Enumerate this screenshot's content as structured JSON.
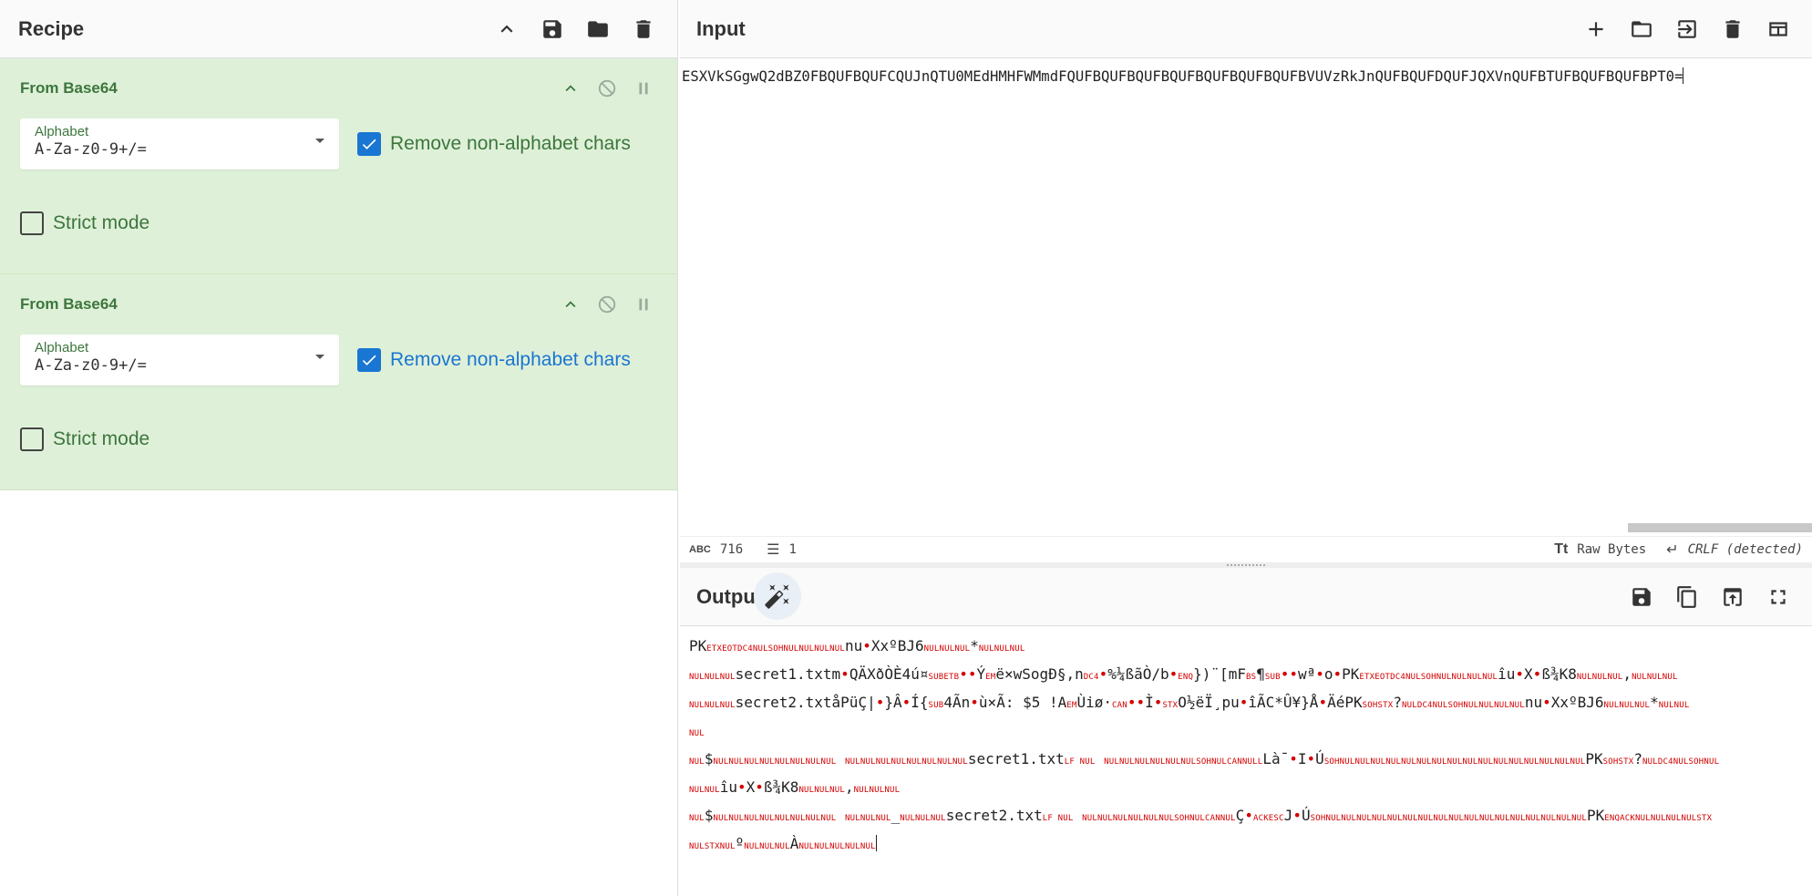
{
  "recipe": {
    "title": "Recipe",
    "operations": [
      {
        "title": "From Base64",
        "alphabet_label": "Alphabet",
        "alphabet_value": "A-Za-z0-9+/=",
        "remove_non_alpha_label": "Remove non-alphabet chars",
        "remove_non_alpha_checked": true,
        "strict_mode_label": "Strict mode",
        "strict_mode_checked": false
      },
      {
        "title": "From Base64",
        "alphabet_label": "Alphabet",
        "alphabet_value": "A-Za-z0-9+/=",
        "remove_non_alpha_label": "Remove non-alphabet chars",
        "remove_non_alpha_checked": true,
        "strict_mode_label": "Strict mode",
        "strict_mode_checked": false
      }
    ]
  },
  "input": {
    "title": "Input",
    "text": "ESXVkSGgwQ2dBZ0FBQUFBQUFCQUJnQTU0MEdHMHFWMmdFQUFBQUFBQUFBQUFBQUFBQUFBQUFBVUVzRkJnQUFBQUFDQUFJQXVnQUFBTUFBQUFBQUFBPT0=",
    "status": {
      "chars_icon": "ABC",
      "chars": "716",
      "lines": "1",
      "encoding": "Raw Bytes",
      "eol": "CRLF (detected)"
    }
  },
  "output": {
    "title": "Output",
    "lines": [
      [
        [
          "t",
          "PK"
        ],
        [
          "c",
          "ETXEOTDC4NULSOHNULNULNULNUL"
        ],
        [
          "t",
          "nu"
        ],
        [
          "d",
          "•"
        ],
        [
          "t",
          "XxºBJ6"
        ],
        [
          "c",
          "NULNULNUL"
        ],
        [
          "t",
          "*"
        ],
        [
          "c",
          "NULNULNUL"
        ]
      ],
      [
        [
          "c",
          "NULNULNUL"
        ],
        [
          "t",
          "secret1.txtm"
        ],
        [
          "d",
          "•"
        ],
        [
          "t",
          "QÄXðÒÈ4ú¤"
        ],
        [
          "c",
          "SUBETB"
        ],
        [
          "d",
          "••"
        ],
        [
          "t",
          "Ý"
        ],
        [
          "c",
          "EM"
        ],
        [
          "t",
          "ë×wSogÐ§,n"
        ],
        [
          "c",
          "DC4"
        ],
        [
          "d",
          "•"
        ],
        [
          "t",
          "%¼ßãÒ/b"
        ],
        [
          "d",
          "•"
        ],
        [
          "c",
          "ENQ"
        ],
        [
          "t",
          "})¨[mF"
        ],
        [
          "c",
          "BS"
        ],
        [
          "t",
          "¶"
        ],
        [
          "c",
          "SUB"
        ],
        [
          "d",
          "••"
        ],
        [
          "t",
          "wª"
        ],
        [
          "d",
          "•"
        ],
        [
          "t",
          "o"
        ],
        [
          "d",
          "•"
        ],
        [
          "t",
          "PK"
        ],
        [
          "c",
          "ETXEOTDC4NULSOHNULNULNULNUL"
        ],
        [
          "t",
          "îu"
        ],
        [
          "d",
          "•"
        ],
        [
          "t",
          "X"
        ],
        [
          "d",
          "•"
        ],
        [
          "t",
          "ß¾K8"
        ],
        [
          "c",
          "NULNULNUL"
        ],
        [
          "t",
          ","
        ],
        [
          "c",
          "NULNULNUL"
        ]
      ],
      [
        [
          "c",
          "NULNULNUL"
        ],
        [
          "t",
          "secret2.txtåPüÇ|"
        ],
        [
          "d",
          "•"
        ],
        [
          "t",
          "}Â"
        ],
        [
          "d",
          "•"
        ],
        [
          "t",
          "Í{"
        ],
        [
          "c",
          "SUB"
        ],
        [
          "t",
          "4Ãn"
        ],
        [
          "d",
          "•"
        ],
        [
          "t",
          "ù×Ã:   $5 !A"
        ],
        [
          "c",
          "EM"
        ],
        [
          "t",
          "Ùiø·"
        ],
        [
          "c",
          "CAN"
        ],
        [
          "d",
          "••"
        ],
        [
          "t",
          "Ì"
        ],
        [
          "d",
          "•"
        ],
        [
          "c",
          "STX"
        ],
        [
          "t",
          "O½ëÏ¸pu"
        ],
        [
          "d",
          "•"
        ],
        [
          "t",
          "îÃC*Û¥}Å"
        ],
        [
          "d",
          "•"
        ],
        [
          "t",
          "ÄéPK"
        ],
        [
          "c",
          "SOHSTX"
        ],
        [
          "t",
          "?"
        ],
        [
          "c",
          "NULDC4NULSOHNULNULNULNUL"
        ],
        [
          "t",
          "nu"
        ],
        [
          "d",
          "•"
        ],
        [
          "t",
          "XxºBJ6"
        ],
        [
          "c",
          "NULNULNUL"
        ],
        [
          "t",
          "*"
        ],
        [
          "c",
          "NULNUL"
        ]
      ],
      [
        [
          "c",
          "NUL"
        ]
      ],
      [
        [
          "c",
          "NUL"
        ],
        [
          "t",
          "$"
        ],
        [
          "c",
          "NULNULNULNULNULNULNULNUL"
        ],
        [
          "t",
          "  "
        ],
        [
          "c",
          "NULNULNULNULNULNULNULNUL"
        ],
        [
          "t",
          "secret1.txt"
        ],
        [
          "c",
          "LF NUL"
        ],
        [
          "t",
          "  "
        ],
        [
          "c",
          "NULNULNULNULNULNULSOHNULCANNULL"
        ],
        [
          "t",
          "Là¯"
        ],
        [
          "d",
          "•"
        ],
        [
          "t",
          "I"
        ],
        [
          "d",
          "•"
        ],
        [
          "t",
          "Ú"
        ],
        [
          "c",
          "SOHNULNULNULNULNULNULNULNULNULNULNULNULNULNULNULNUL"
        ],
        [
          "t",
          "PK"
        ],
        [
          "c",
          "SOHSTX"
        ],
        [
          "t",
          "?"
        ],
        [
          "c",
          "NULDC4NULSOHNUL"
        ]
      ],
      [
        [
          "c",
          "NULNUL"
        ],
        [
          "t",
          "îu"
        ],
        [
          "d",
          "•"
        ],
        [
          "t",
          "X"
        ],
        [
          "d",
          "•"
        ],
        [
          "t",
          "ß¾K8"
        ],
        [
          "c",
          "NULNULNUL"
        ],
        [
          "t",
          ","
        ],
        [
          "c",
          "NULNULNUL"
        ]
      ],
      [
        [
          "c",
          "NUL"
        ],
        [
          "t",
          "$"
        ],
        [
          "c",
          "NULNULNULNULNULNULNULNUL"
        ],
        [
          "t",
          "  "
        ],
        [
          "c",
          "NULNULNUL"
        ],
        [
          "t",
          "_"
        ],
        [
          "c",
          "NULNULNUL"
        ],
        [
          "t",
          "secret2.txt"
        ],
        [
          "c",
          "LF NUL"
        ],
        [
          "t",
          "  "
        ],
        [
          "c",
          "NULNULNULNULNULNULSOHNULCANNUL"
        ],
        [
          "t",
          "Ç"
        ],
        [
          "d",
          "•"
        ],
        [
          "c",
          "ACKESC"
        ],
        [
          "t",
          "J"
        ],
        [
          "d",
          "•"
        ],
        [
          "t",
          "Ú"
        ],
        [
          "c",
          "SOHNULNULNULNULNULNULNULNULNULNULNULNULNULNULNULNULNUL"
        ],
        [
          "t",
          "PK"
        ],
        [
          "c",
          "ENQACKNULNULNULNULSTX"
        ]
      ],
      [
        [
          "c",
          "NULSTXNUL"
        ],
        [
          "t",
          "º"
        ],
        [
          "c",
          "NULNULNUL"
        ],
        [
          "t",
          "À"
        ],
        [
          "c",
          "NULNULNULNULNUL"
        ]
      ]
    ]
  }
}
